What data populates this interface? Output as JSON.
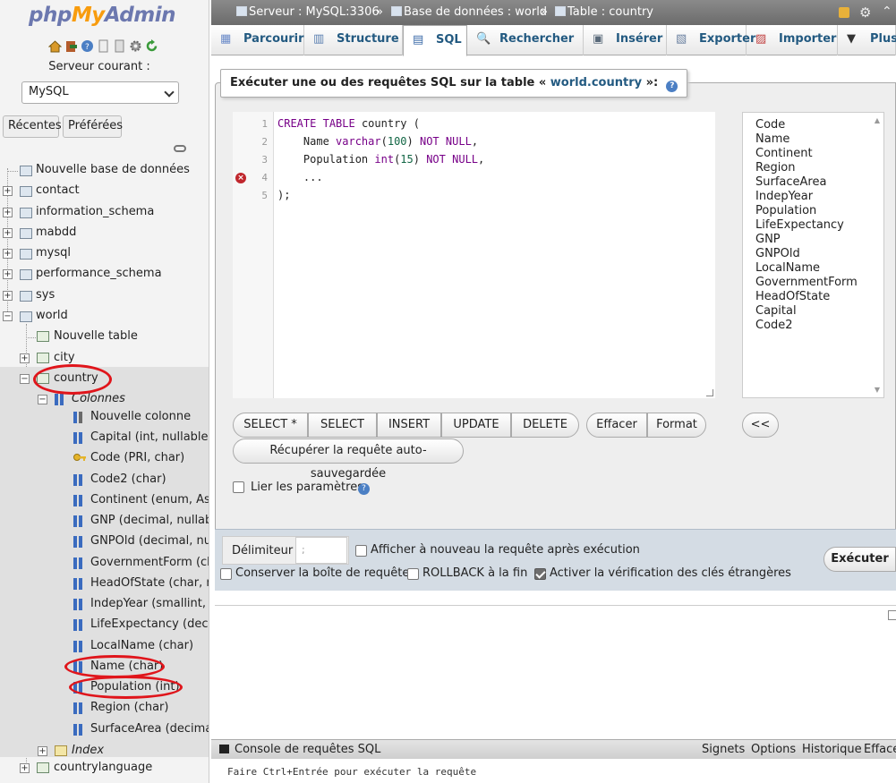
{
  "app": {
    "logo_php": "php",
    "logo_my": "My",
    "logo_admin": "Admin",
    "current_server_label": "Serveur courant :",
    "server_select_value": "MySQL",
    "recent_label": "Récentes",
    "favorites_label": "Préférées"
  },
  "tree": {
    "new_db": "Nouvelle base de données",
    "dbs": [
      "contact",
      "information_schema",
      "mabdd",
      "mysql",
      "performance_schema",
      "sys",
      "world"
    ],
    "new_table": "Nouvelle table",
    "city": "city",
    "country": "country",
    "columns_label": "Colonnes",
    "new_column": "Nouvelle colonne",
    "columns": [
      "Capital (int, nullable)",
      "Code (PRI, char)",
      "Code2 (char)",
      "Continent (enum, Asia",
      "GNP (decimal, nullable",
      "GNPOld (decimal, null",
      "GovernmentForm (cha",
      "HeadOfState (char, nu",
      "IndepYear (smallint, nu",
      "LifeExpectancy (decim",
      "LocalName (char)",
      "Name (char)",
      "Population (int)",
      "Region (char)",
      "SurfaceArea (decimal,"
    ],
    "index_label": "Index",
    "countrylanguage": "countrylanguage"
  },
  "breadcrumb": {
    "server": "Serveur : MySQL:3306",
    "database": "Base de données : world",
    "table": "Table : country",
    "sep": "»"
  },
  "tabs": [
    "Parcourir",
    "Structure",
    "SQL",
    "Rechercher",
    "Insérer",
    "Exporter",
    "Importer",
    "Plus"
  ],
  "sql_panel": {
    "legend_prefix": "Exécuter une ou des requêtes SQL sur la table «",
    "legend_table": "world.country",
    "legend_suffix": "»:",
    "line_numbers": [
      "1",
      "2",
      "3",
      "4",
      "5"
    ],
    "code_lines": [
      "CREATE TABLE country (",
      "    Name varchar(100) NOT NULL,",
      "    Population int(15) NOT NULL,",
      "    ...",
      ");"
    ],
    "column_list": [
      "Code",
      "Name",
      "Continent",
      "Region",
      "SurfaceArea",
      "IndepYear",
      "Population",
      "LifeExpectancy",
      "GNP",
      "GNPOld",
      "LocalName",
      "GovernmentForm",
      "HeadOfState",
      "Capital",
      "Code2"
    ],
    "buttons": {
      "select_star": "SELECT *",
      "select": "SELECT",
      "insert": "INSERT",
      "update": "UPDATE",
      "delete": "DELETE",
      "clear": "Effacer",
      "format": "Format",
      "insert_col": "<<",
      "recover": "Récupérer la requête auto-sauvegardée"
    },
    "bind_params_label": "Lier les paramètres"
  },
  "options": {
    "delimiter_label": "Délimiteur",
    "delimiter_value": ";",
    "show_again": "Afficher à nouveau la requête après exécution",
    "keep_box": "Conserver la boîte de requêtes",
    "rollback": "ROLLBACK à la fin",
    "fk_check": "Activer la vérification des clés étrangères",
    "execute": "Exécuter"
  },
  "console": {
    "title": "Console de requêtes SQL",
    "bookmarks": "Signets",
    "options": "Options",
    "history": "Historique",
    "clear": "Efface",
    "hint": "Faire Ctrl+Entrée pour exécuter la requête"
  },
  "colors": {
    "accent": "#235a81",
    "annotation_red": "#e0151b"
  }
}
